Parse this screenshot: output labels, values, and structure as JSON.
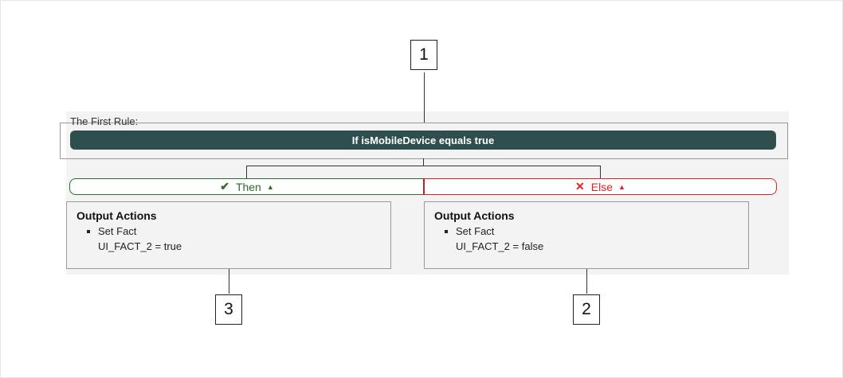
{
  "rule": {
    "title": "The First Rule:",
    "condition": "If isMobileDevice equals true"
  },
  "branches": {
    "then": {
      "label": "Then",
      "color": "#2e6b2e"
    },
    "else": {
      "label": "Else",
      "color": "#dd2222"
    }
  },
  "outputs": {
    "then": {
      "title": "Output Actions",
      "item": "Set Fact",
      "detail": "UI_FACT_2 = true"
    },
    "else": {
      "title": "Output Actions",
      "item": "Set Fact",
      "detail": "UI_FACT_2 = false"
    }
  },
  "callouts": {
    "condition": "1",
    "else_output": "2",
    "then_output": "3"
  },
  "colors": {
    "condition_bar": "#2f4f4f",
    "panel": "#f3f3f3"
  },
  "icons": {
    "then": "check-icon",
    "else": "x-icon",
    "caret": "caret-up-icon"
  }
}
